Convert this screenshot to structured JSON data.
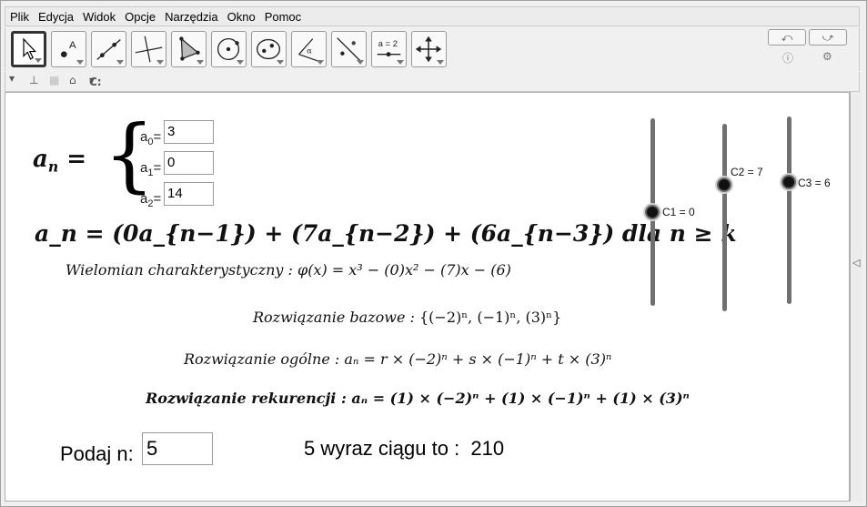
{
  "menu": [
    "Plik",
    "Edycja",
    "Widok",
    "Opcje",
    "Narzędzia",
    "Okno",
    "Pomoc"
  ],
  "toolbar": {
    "tools": [
      {
        "name": "move-tool",
        "icon": "arrow-cursor-icon"
      },
      {
        "name": "point-tool",
        "icon": "point-icon",
        "text": "A"
      },
      {
        "name": "line-tool",
        "icon": "line-icon"
      },
      {
        "name": "perpendicular-tool",
        "icon": "perpendicular-line-icon"
      },
      {
        "name": "polygon-tool",
        "icon": "polygon-icon"
      },
      {
        "name": "circle-tool",
        "icon": "circle-icon"
      },
      {
        "name": "conic-tool",
        "icon": "ellipse-icon"
      },
      {
        "name": "angle-tool",
        "icon": "angle-icon",
        "text": "α"
      },
      {
        "name": "reflect-tool",
        "icon": "reflect-icon"
      },
      {
        "name": "slider-tool",
        "icon": "slider-icon",
        "text": "a = 2"
      },
      {
        "name": "move-view-tool",
        "icon": "move-graphics-icon"
      }
    ],
    "undo_icon": "undo-icon",
    "redo_icon": "redo-icon",
    "help_icon": "help-icon",
    "settings_icon": "settings-icon"
  },
  "stylebar": {
    "toggle_icon": "triangle-down-icon",
    "axes_icon": "axes-icon",
    "grid_icon": "grid-icon",
    "home_icon": "home-icon",
    "label_text": "C:"
  },
  "formula": {
    "an_label": "a",
    "an_sub": "n",
    "eq": "=",
    "initial": [
      {
        "label": "a",
        "sub": "0",
        "value": "3"
      },
      {
        "label": "a",
        "sub": "1",
        "value": "0"
      },
      {
        "label": "a",
        "sub": "2",
        "value": "14"
      }
    ],
    "recurrence": "a_n = (0a_{n−1}) + (7a_{n−2}) + (6a_{n−3})  dla n ≥ k",
    "characteristic_label": "Wielomian charakterystyczny :",
    "characteristic_formula": "φ(x) = x³ − (0)x² − (7)x − (6)",
    "base_label": "Rozwiązanie bazowe :",
    "base_formula": "{(−2)ⁿ, (−1)ⁿ, (3)ⁿ}",
    "general_label": "Rozwiązanie ogólne :",
    "general_formula": "aₙ = r × (−2)ⁿ + s × (−1)ⁿ + t × (3)ⁿ",
    "solution_label": "Rozwiązanie rekurencji :",
    "solution_formula": "aₙ = (1) × (−2)ⁿ + (1) × (−1)ⁿ + (1) × (3)ⁿ"
  },
  "sliders": [
    {
      "label": "C1 = 0",
      "value": 0,
      "min": 0,
      "max": 10
    },
    {
      "label": "C2 = 7",
      "value": 7,
      "min": 0,
      "max": 10
    },
    {
      "label": "C3 = 6",
      "value": 6,
      "min": 0,
      "max": 10
    }
  ],
  "input_n": {
    "label": "Podaj n:",
    "value": "5"
  },
  "result": {
    "text": "5 wyraz ciągu to :",
    "value": "210"
  },
  "colors": {
    "window_bg": "#f0f0f0",
    "canvas_bg": "#ffffff",
    "slider_track": "#707070",
    "slider_knob": "#111111"
  }
}
